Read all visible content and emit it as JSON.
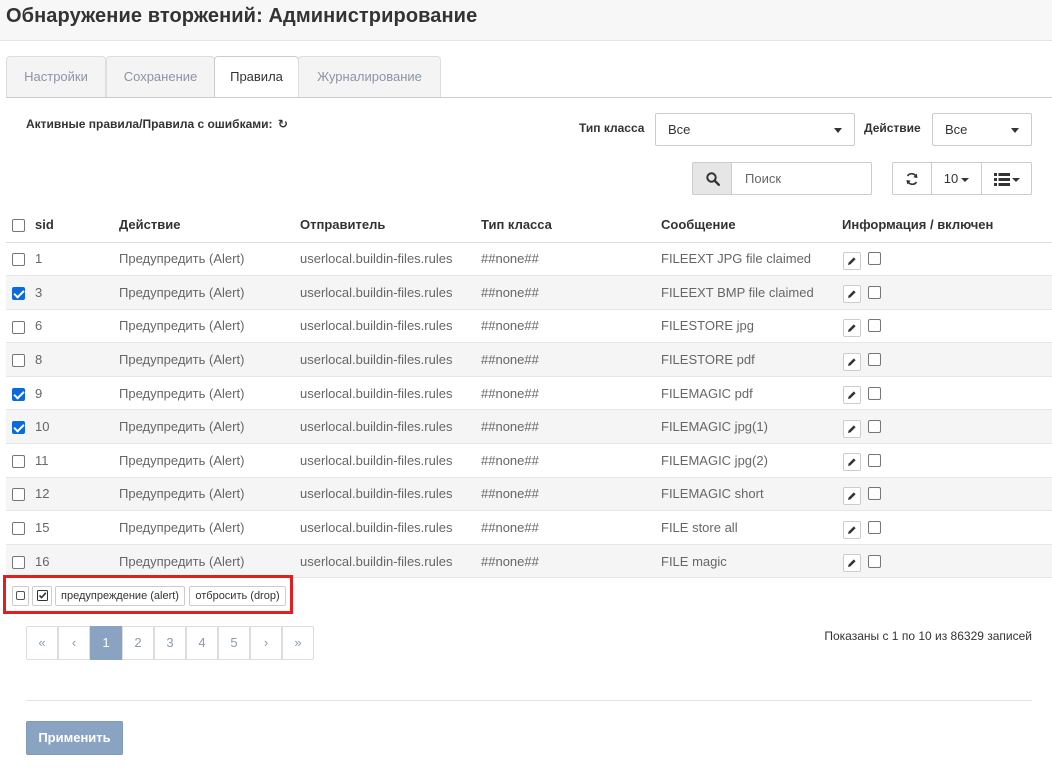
{
  "page": {
    "title": "Обнаружение вторжений: Администрирование"
  },
  "tabs": [
    {
      "label": "Настройки",
      "active": false
    },
    {
      "label": "Сохранение",
      "active": false
    },
    {
      "label": "Правила",
      "active": true
    },
    {
      "label": "Журналирование",
      "active": false
    }
  ],
  "toolbar": {
    "active_rules_label": "Активные правила/Правила с ошибками:",
    "refresh_icon": "↻",
    "class_type_label": "Тип класса",
    "class_type_value": "Все",
    "action_label": "Действие",
    "action_value": "Все",
    "search_placeholder": "Поиск",
    "search_icon": "search-icon",
    "page_size": "10",
    "refresh_button_icon": "refresh-icon",
    "columns_button_icon": "list-icon"
  },
  "table": {
    "headers": {
      "sid": "sid",
      "action": "Действие",
      "source": "Отправитель",
      "class_type": "Тип класса",
      "message": "Сообщение",
      "info": "Информация / включен"
    },
    "rows": [
      {
        "sid": "1",
        "action": "Предупредить (Alert)",
        "source": "userlocal.buildin-files.rules",
        "class_type": "##none##",
        "message": "FILEEXT JPG file claimed",
        "selected": false
      },
      {
        "sid": "3",
        "action": "Предупредить (Alert)",
        "source": "userlocal.buildin-files.rules",
        "class_type": "##none##",
        "message": "FILEEXT BMP file claimed",
        "selected": true
      },
      {
        "sid": "6",
        "action": "Предупредить (Alert)",
        "source": "userlocal.buildin-files.rules",
        "class_type": "##none##",
        "message": "FILESTORE jpg",
        "selected": false
      },
      {
        "sid": "8",
        "action": "Предупредить (Alert)",
        "source": "userlocal.buildin-files.rules",
        "class_type": "##none##",
        "message": "FILESTORE pdf",
        "selected": false
      },
      {
        "sid": "9",
        "action": "Предупредить (Alert)",
        "source": "userlocal.buildin-files.rules",
        "class_type": "##none##",
        "message": "FILEMAGIC pdf",
        "selected": true
      },
      {
        "sid": "10",
        "action": "Предупредить (Alert)",
        "source": "userlocal.buildin-files.rules",
        "class_type": "##none##",
        "message": "FILEMAGIC jpg(1)",
        "selected": true
      },
      {
        "sid": "11",
        "action": "Предупредить (Alert)",
        "source": "userlocal.buildin-files.rules",
        "class_type": "##none##",
        "message": "FILEMAGIC jpg(2)",
        "selected": false
      },
      {
        "sid": "12",
        "action": "Предупредить (Alert)",
        "source": "userlocal.buildin-files.rules",
        "class_type": "##none##",
        "message": "FILEMAGIC short",
        "selected": false
      },
      {
        "sid": "15",
        "action": "Предупредить (Alert)",
        "source": "userlocal.buildin-files.rules",
        "class_type": "##none##",
        "message": "FILE store all",
        "selected": false
      },
      {
        "sid": "16",
        "action": "Предупредить (Alert)",
        "source": "userlocal.buildin-files.rules",
        "class_type": "##none##",
        "message": "FILE magic",
        "selected": false
      }
    ]
  },
  "bulk_actions": {
    "alert_label": "предупреждение (alert)",
    "drop_label": "отбросить (drop)"
  },
  "pagination": {
    "first": "«",
    "prev": "‹",
    "pages": [
      "1",
      "2",
      "3",
      "4",
      "5"
    ],
    "current": "1",
    "next": "›",
    "last": "»",
    "summary": "Показаны с 1 по 10 из 86329 записей"
  },
  "footer": {
    "apply_label": "Применить"
  },
  "colors": {
    "accent": "#8aa3c2",
    "checkbox": "#0b69e0",
    "highlight_border": "#e02020"
  }
}
